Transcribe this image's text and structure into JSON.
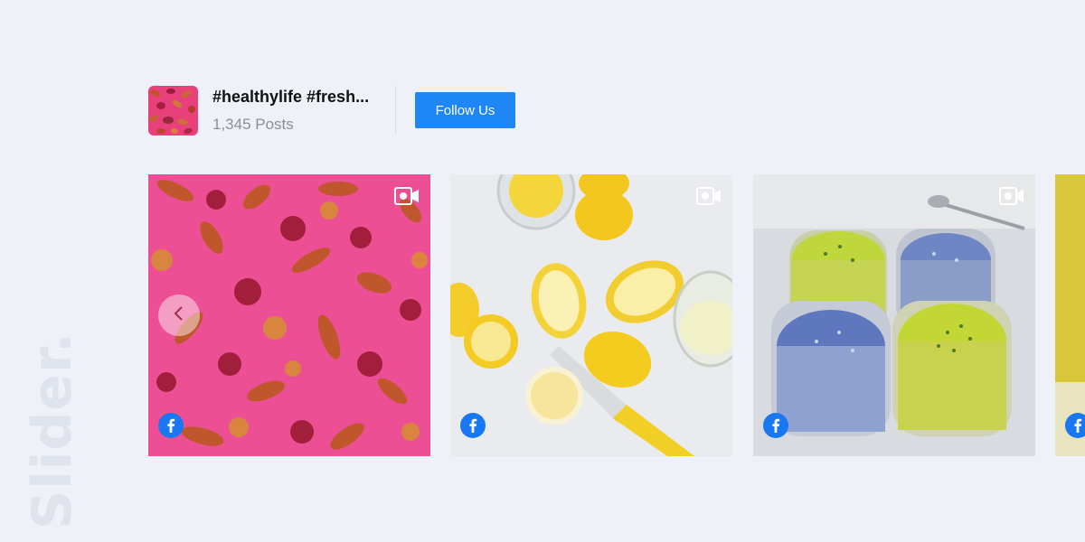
{
  "watermark": "Slider.",
  "header": {
    "title": "#healthylife #fresh...",
    "post_count": "1,345 Posts",
    "follow_label": "Follow Us"
  },
  "slides": [
    {
      "subject": "dried vegetable chips on pink background",
      "source": "facebook-icon",
      "type": "video-icon"
    },
    {
      "subject": "sliced lemons and juice on white table",
      "source": "facebook-icon",
      "type": "video-icon"
    },
    {
      "subject": "blue and green smoothies in glasses",
      "source": "facebook-icon",
      "type": "video-icon"
    },
    {
      "subject": "partially visible yellow drink",
      "source": "facebook-icon"
    }
  ],
  "colors": {
    "background": "#eef1f8",
    "accent": "#1e86f5",
    "facebook": "#1877f2",
    "watermark": "#dfe3ec"
  }
}
